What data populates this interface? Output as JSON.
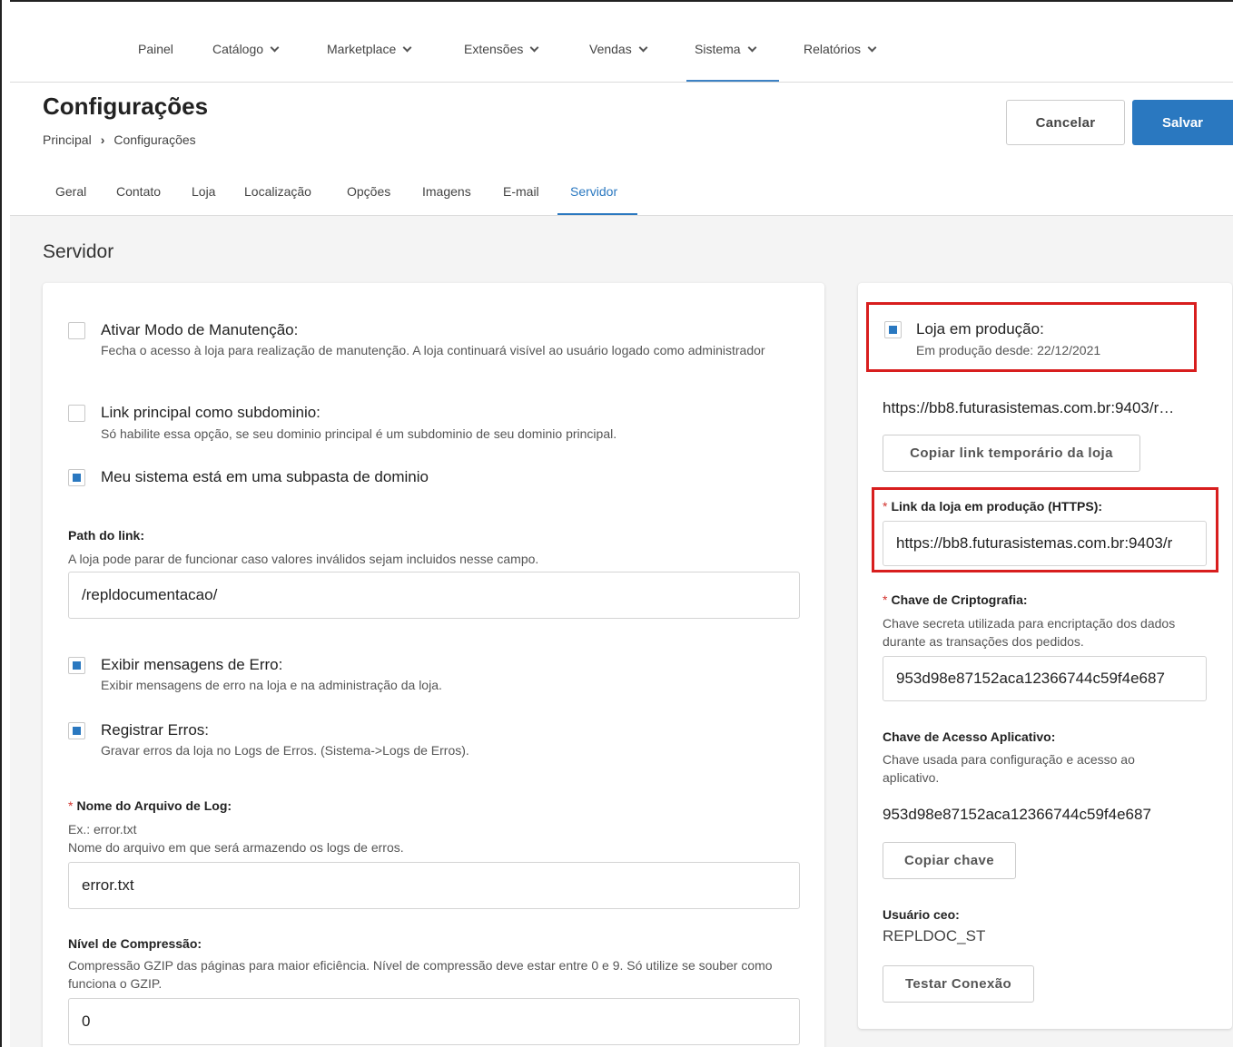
{
  "nav": {
    "items": [
      {
        "label": "Painel",
        "dropdown": false
      },
      {
        "label": "Catálogo",
        "dropdown": true
      },
      {
        "label": "Marketplace",
        "dropdown": true
      },
      {
        "label": "Extensões",
        "dropdown": true
      },
      {
        "label": "Vendas",
        "dropdown": true
      },
      {
        "label": "Sistema",
        "dropdown": true,
        "active": true
      },
      {
        "label": "Relatórios",
        "dropdown": true
      }
    ]
  },
  "header": {
    "title": "Configurações",
    "breadcrumb": [
      "Principal",
      "Configurações"
    ],
    "cancel_label": "Cancelar",
    "save_label": "Salvar"
  },
  "tabs": {
    "items": [
      "Geral",
      "Contato",
      "Loja",
      "Localização",
      "Opções",
      "Imagens",
      "E-mail",
      "Servidor"
    ],
    "active": "Servidor"
  },
  "section": {
    "title": "Servidor"
  },
  "left": {
    "maintenance": {
      "label": "Ativar Modo de Manutenção:",
      "desc": "Fecha o acesso à loja para realização de manutenção. A loja continuará visível ao usuário logado como administrador",
      "checked": false
    },
    "subdomain": {
      "label": "Link principal como subdominio:",
      "desc": "Só habilite essa opção, se seu dominio principal é um subdominio de seu dominio principal.",
      "checked": false
    },
    "subfolder": {
      "label": "Meu sistema está em uma subpasta de dominio",
      "checked": true
    },
    "path": {
      "label": "Path do link:",
      "help": "A loja pode parar de funcionar caso valores inválidos sejam incluidos nesse campo.",
      "value": "/repldocumentacao/"
    },
    "show_errors": {
      "label": "Exibir mensagens de Erro:",
      "desc": "Exibir mensagens de erro na loja e na administração da loja.",
      "checked": true
    },
    "log_errors": {
      "label": "Registrar Erros:",
      "desc": "Gravar erros da loja no Logs de Erros. (Sistema->Logs de Erros).",
      "checked": true
    },
    "log_file": {
      "required": "*",
      "label": "Nome do Arquivo de Log:",
      "example": "Ex.: error.txt",
      "help": "Nome do arquivo em que será armazendo os logs de erros.",
      "value": "error.txt"
    },
    "compression": {
      "label": "Nível de Compressão:",
      "help": "Compressão GZIP das páginas para maior eficiência. Nível de compressão deve estar entre 0 e 9. Só utilize se souber como funciona o GZIP.",
      "value": "0"
    }
  },
  "right": {
    "production": {
      "label": "Loja em produção:",
      "since": "Em produção desde: 22/12/2021",
      "checked": true
    },
    "temp_link": "https://bb8.futurasistemas.com.br:9403/r…",
    "copy_temp_label": "Copiar link temporário da loja",
    "prod_link": {
      "required": "*",
      "label": "Link da loja em produção (HTTPS):",
      "value": "https://bb8.futurasistemas.com.br:9403/r"
    },
    "crypto": {
      "required": "*",
      "label": "Chave de Criptografia:",
      "help": "Chave secreta utilizada para encriptação dos dados durante as transações dos pedidos.",
      "value": "953d98e87152aca12366744c59f4e687"
    },
    "app_key": {
      "label": "Chave de Acesso Aplicativo:",
      "help": "Chave usada para configuração e acesso ao aplicativo.",
      "value": "953d98e87152aca12366744c59f4e687"
    },
    "copy_key_label": "Copiar chave",
    "ceo_user": {
      "label": "Usuário ceo:",
      "value": "REPLDOC_ST"
    },
    "test_conn_label": "Testar Conexão"
  },
  "colors": {
    "accent": "#2a78c0",
    "highlight": "#d81e1e",
    "required": "#d2322d"
  }
}
